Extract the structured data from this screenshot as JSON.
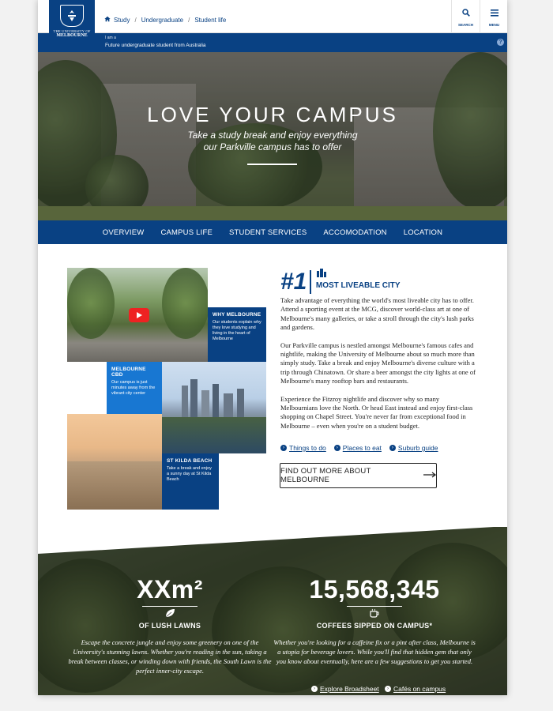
{
  "header": {
    "logo_line1": "THE UNIVERSITY OF",
    "logo_line2": "MELBOURNE",
    "breadcrumb": [
      "Study",
      "Undergraduate",
      "Student life"
    ],
    "search_label": "SEARCH",
    "menu_label": "MENU"
  },
  "persona": {
    "prefix": "I am a",
    "value": "Future undergraduate student from Australia",
    "help": "?"
  },
  "hero": {
    "title": "LOVE YOUR CAMPUS",
    "subtitle_line1": "Take a study break and enjoy everything",
    "subtitle_line2": "our Parkville campus has to offer"
  },
  "tabs": [
    "OVERVIEW",
    "CAMPUS LIFE",
    "STUDENT SERVICES",
    "ACCOMODATION",
    "LOCATION"
  ],
  "mosaic": {
    "why": {
      "title": "WHY MELBOURNE",
      "desc": "Our students explain why they love studying and living in the heart of Melbourne"
    },
    "cbd": {
      "title": "MELBOURNE CBD",
      "desc": "Our campus is just minutes away from the vibrant city center"
    },
    "kilda": {
      "title": "ST KILDA BEACH",
      "desc": "Take a break and enjoy a sunny day at St Kilda Beach"
    }
  },
  "rank": {
    "number": "#1",
    "label": "MOST LIVEABLE CITY"
  },
  "copy": [
    "Take advantage of everything the world's most liveable city has to offer. Attend a sporting event at the MCG, discover world-class art at one of Melbourne's many galleries, or take a stroll through the city's lush parks and gardens.",
    "Our Parkville campus is nestled amongst Melbourne's famous cafes and nightlife, making the University of Melbourne about so much more than simply study. Take a break and enjoy Melbourne's diverse culture with a trip through Chinatown. Or share a beer amongst the city lights at one of Melbourne's many rooftop bars and restaurants.",
    "Experience the Fitzroy nightlife and discover why so many Melbournians love the North. Or head East instead and enjoy first-class shopping on Chapel Street. You're never far from exceptional food in Melbourne – even when you're on a student budget."
  ],
  "links": [
    "Things to do",
    "Places to eat",
    "Suburb guide"
  ],
  "cta": "FIND OUT MORE ABOUT MELBOURNE",
  "stats": {
    "lawns": {
      "value": "XXm²",
      "caption": "OF LUSH LAWNS",
      "body": "Escape the concrete jungle and enjoy some greenery on one of the University's stunning lawns. Whether you're reading in the sun, taking a break between classes, or winding down with friends, the South Lawn is the perfect inner-city escape.",
      "link": "Explore Broadsheet"
    },
    "coffee": {
      "value": "15,568,345",
      "caption": "COFFEES SIPPED ON CAMPUS*",
      "body": "Whether you're looking for a caffeine fix or a pint after class, Melbourne is a utopia for beverage lovers. While you'll find that hidden gem that only you know about eventually, here are a few suggestions to get you started.",
      "link": "Cafés on campus"
    }
  },
  "colors": {
    "brand": "#094183",
    "accent": "#1877d2"
  }
}
